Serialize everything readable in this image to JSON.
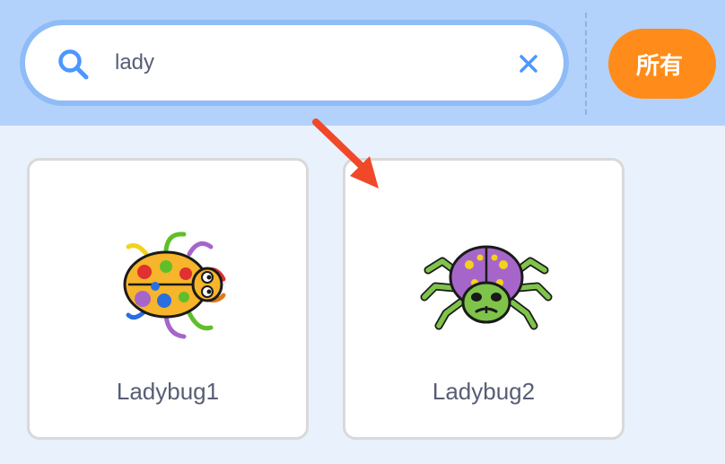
{
  "search": {
    "value": "lady",
    "icon": "search-icon",
    "clear_icon": "close-icon"
  },
  "filter": {
    "all_label": "所有"
  },
  "results": [
    {
      "name": "Ladybug1",
      "icon": "ladybug1-sprite"
    },
    {
      "name": "Ladybug2",
      "icon": "ladybug2-sprite"
    }
  ],
  "colors": {
    "topbar": "#b3d2fb",
    "background": "#e9f1fc",
    "accent_orange": "#ff8c1a",
    "search_icon": "#4c97ff",
    "arrow": "#f0492a",
    "label_text": "#575e75"
  }
}
